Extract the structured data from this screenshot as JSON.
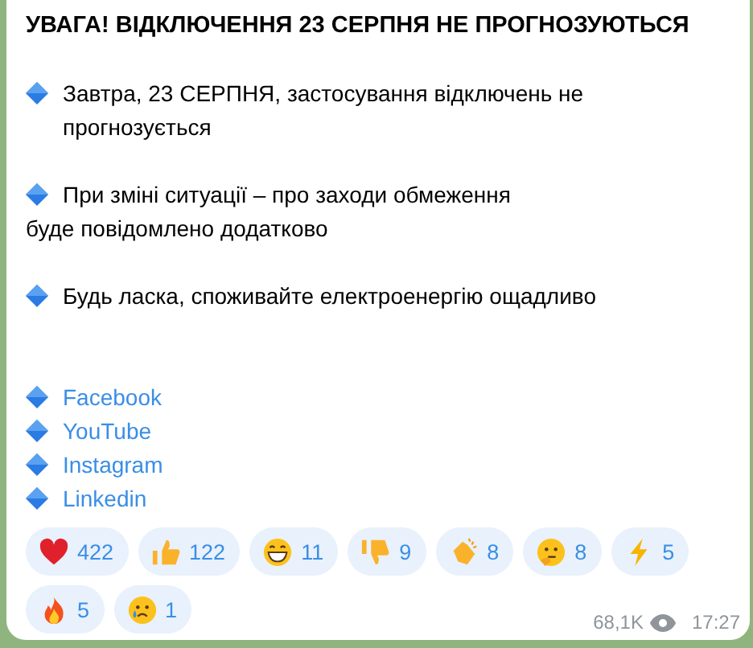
{
  "message": {
    "title": "УВАГА! ВІДКЛЮЧЕННЯ 23 СЕРПНЯ НЕ ПРОГНОЗУЮТЬСЯ",
    "paragraphs": [
      {
        "lines": [
          "Завтра, 23 СЕРПНЯ, застосування відключень не прогнозується"
        ]
      },
      {
        "lines": [
          "При зміні ситуації – про заходи обмеження",
          "буде повідомлено додатково"
        ]
      },
      {
        "lines": [
          "Будь ласка, споживайте електроенергію ощадливо"
        ]
      }
    ],
    "links": [
      "Facebook",
      "YouTube",
      "Instagram",
      "Linkedin"
    ],
    "reactions": [
      {
        "kind": "heart",
        "count": "422"
      },
      {
        "kind": "thumbs-up",
        "count": "122"
      },
      {
        "kind": "grin",
        "count": "11"
      },
      {
        "kind": "thumbs-down",
        "count": "9"
      },
      {
        "kind": "clap",
        "count": "8"
      },
      {
        "kind": "thinking",
        "count": "8"
      },
      {
        "kind": "lightning",
        "count": "5"
      },
      {
        "kind": "fire",
        "count": "5"
      },
      {
        "kind": "cry",
        "count": "1"
      }
    ],
    "views": "68,1K",
    "time": "17:27"
  }
}
